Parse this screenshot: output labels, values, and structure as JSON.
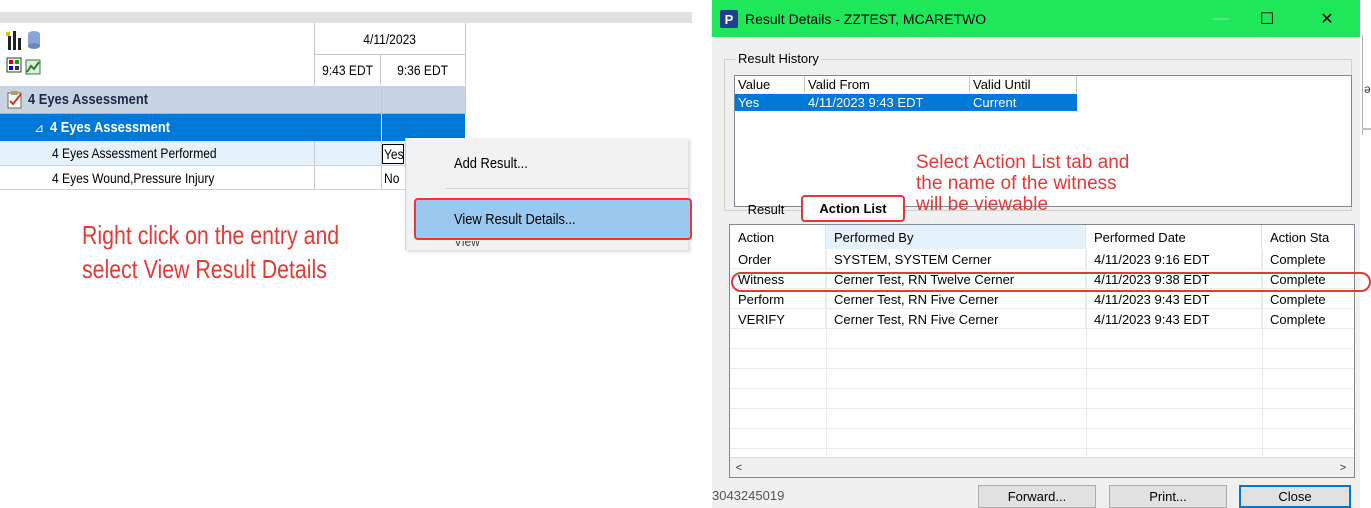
{
  "flowsheet": {
    "date_header": "4/11/2023",
    "times": [
      "9:43 EDT",
      "9:36 EDT"
    ],
    "section_title": "4 Eyes Assessment",
    "group_title": "4 Eyes Assessment",
    "group_toggle": "⊿",
    "rows": [
      {
        "label": "4 Eyes Assessment Performed",
        "value": "Yes"
      },
      {
        "label": "4 Eyes Wound,Pressure Injury",
        "value": "No"
      }
    ]
  },
  "context_menu": {
    "items": [
      "Add Result...",
      "View Result Details...",
      "View Comments"
    ]
  },
  "annotation_left": [
    "Right click on the entry and",
    "select View Result Details"
  ],
  "dialog": {
    "title": "Result Details - ZZTEST, MCARETWO",
    "logo": "P",
    "window_buttons": {
      "minimize": "—",
      "maximize": "☐",
      "close": "✕"
    },
    "result_history": {
      "label": "Result History",
      "columns": [
        "Value",
        "Valid From",
        "Valid Until"
      ],
      "rows": [
        {
          "value": "Yes",
          "valid_from": "4/11/2023 9:43 EDT",
          "valid_until": "Current"
        }
      ]
    },
    "annotation": [
      "Select Action List tab and",
      "the name of the witness",
      "will be viewable"
    ],
    "tabs": [
      "Result",
      "Action List"
    ],
    "active_tab": "Action List",
    "action_list": {
      "columns": [
        "Action",
        "Performed By",
        "Performed Date",
        "Action Sta"
      ],
      "rows": [
        {
          "action": "Order",
          "performed_by": "SYSTEM, SYSTEM Cerner",
          "performed_date": "4/11/2023 9:16 EDT",
          "status": "Complete"
        },
        {
          "action": "Witness",
          "performed_by": "Cerner Test, RN Twelve Cerner",
          "performed_date": "4/11/2023 9:38 EDT",
          "status": "Complete"
        },
        {
          "action": "Perform",
          "performed_by": "Cerner Test, RN Five Cerner",
          "performed_date": "4/11/2023 9:43 EDT",
          "status": "Complete"
        },
        {
          "action": "VERIFY",
          "performed_by": "Cerner Test, RN Five Cerner",
          "performed_date": "4/11/2023 9:43 EDT",
          "status": "Complete"
        }
      ],
      "scroll_left": "<",
      "scroll_right": ">"
    },
    "footer": {
      "id": "3043245019",
      "buttons": [
        "Forward...",
        "Print...",
        "Close"
      ]
    }
  },
  "edge_char": "ə",
  "colors": {
    "titlebar": "#1ee85a",
    "selection": "#0078d7",
    "section_bg": "#c8d4e4",
    "annotation_red": "#e53935",
    "menu_highlight": "#99c9ef"
  }
}
